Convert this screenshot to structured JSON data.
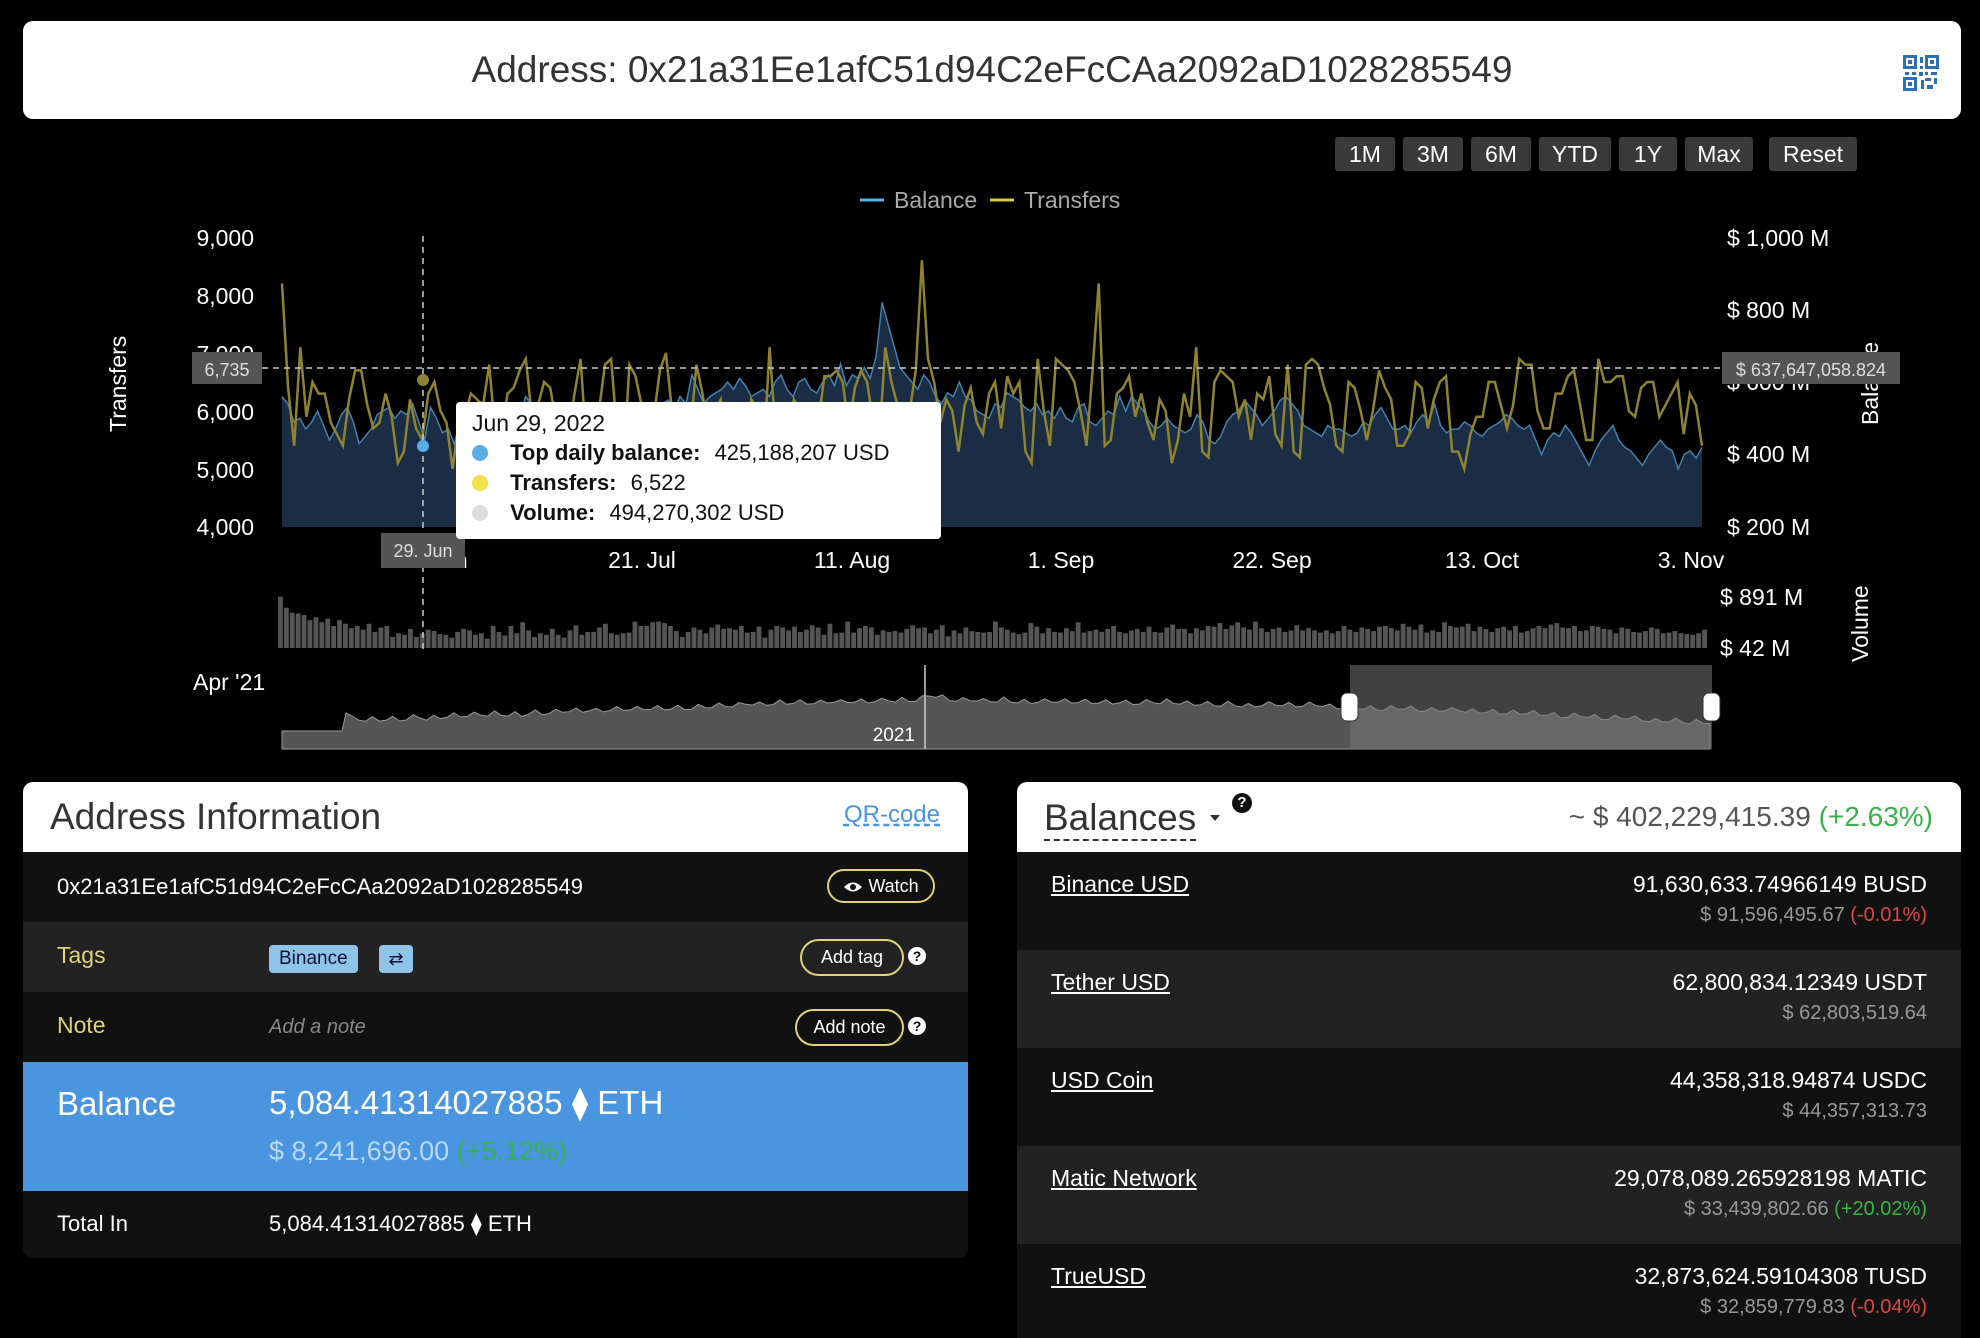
{
  "header": {
    "prefix": "Address:",
    "address": "0x21a31Ee1afC51d94C2eFcCAa2092aD1028285549"
  },
  "range_buttons": [
    "1M",
    "3M",
    "6M",
    "YTD",
    "1Y",
    "Max",
    "Reset"
  ],
  "colors": {
    "balance": "#5aaee8",
    "transfers": "#d8c84a",
    "volume": "#666666",
    "accent_blue": "#4a95df",
    "positive": "#38b24a",
    "negative": "#d94a4a",
    "tag_border": "#e2d17a"
  },
  "chart_data": {
    "type": "line",
    "legend": [
      "Balance",
      "Transfers"
    ],
    "legend_placement": "top-center",
    "x_ticks": [
      "30. Jun",
      "21. Jul",
      "11. Aug",
      "1. Sep",
      "22. Sep",
      "13. Oct",
      "3. Nov"
    ],
    "left_axis": {
      "label": "Transfers",
      "ticks": [
        "9,000",
        "8,000",
        "7,000",
        "6,000",
        "5,000",
        "4,000"
      ],
      "range": [
        4000,
        9000
      ]
    },
    "right_axis": {
      "label": "Balance",
      "ticks": [
        "$ 1,000 M",
        "$ 800 M",
        "$ 600 M",
        "$ 400 M",
        "$ 200 M"
      ],
      "range": [
        200000000,
        1000000000
      ]
    },
    "volume_axis": {
      "label": "Volume",
      "ticks": [
        "$ 891 M",
        "$ 42 M"
      ]
    },
    "crosshair": {
      "left_value": "6,735",
      "right_value": "$ 637,647,058.824",
      "x_label": "29. Jun"
    },
    "tooltip": {
      "date": "Jun 29, 2022",
      "rows": [
        {
          "label": "Top daily balance:",
          "value": "425,188,207 USD",
          "color": "#5aaee8"
        },
        {
          "label": "Transfers:",
          "value": "6,522",
          "color": "#f2e34a"
        },
        {
          "label": "Volume:",
          "value": "494,270,302 USD",
          "color": "#dddddd"
        }
      ]
    },
    "navigator": {
      "start_label": "Apr '21",
      "year_label": "2021"
    },
    "transfers": [
      8200,
      6400,
      5400,
      7100,
      5900,
      6500,
      6300,
      6300,
      5800,
      5600,
      5400,
      6200,
      6700,
      6700,
      6100,
      5700,
      5800,
      6300,
      5900,
      5100,
      5300,
      6200,
      5700,
      5500,
      6300,
      6500,
      6000,
      5800,
      5000,
      5800,
      5900,
      6300,
      6200,
      6100,
      6800,
      5600,
      5600,
      6300,
      6400,
      6700,
      6900,
      5900,
      6100,
      6500,
      6400,
      5800,
      5400,
      5600,
      6300,
      6900,
      5300,
      5400,
      6000,
      6800,
      6900,
      5600,
      5000,
      6800,
      6600,
      6100,
      5700,
      5900,
      6700,
      7000,
      6000,
      5400,
      5100,
      5600,
      6800,
      6300,
      5600,
      6000,
      6200,
      5400,
      5500,
      5200,
      4600,
      6200,
      6000,
      5200,
      7100,
      5600,
      6000,
      5500,
      6200,
      6000,
      5500,
      5500,
      5800,
      6600,
      6600,
      6700,
      6500,
      5700,
      6400,
      6700,
      6500,
      5800,
      5500,
      7100,
      6500,
      6100,
      5600,
      6000,
      6700,
      8600,
      6900,
      6500,
      5800,
      6200,
      6000,
      5300,
      6100,
      6400,
      5800,
      5600,
      6300,
      6500,
      5700,
      6600,
      6300,
      6500,
      5300,
      5100,
      6900,
      6000,
      5400,
      6900,
      6800,
      6700,
      6500,
      6000,
      5400,
      6700,
      8200,
      5400,
      5500,
      6300,
      6400,
      6600,
      5900,
      6300,
      5800,
      5500,
      6200,
      6000,
      5100,
      5500,
      6300,
      5900,
      7100,
      5300,
      5200,
      6500,
      6700,
      6600,
      6500,
      5900,
      6200,
      5500,
      6300,
      6200,
      6600,
      5600,
      5400,
      6800,
      5300,
      5200,
      6800,
      6900,
      6800,
      6400,
      6100,
      5400,
      5300,
      6500,
      6400,
      6000,
      5500,
      6000,
      6700,
      6400,
      6200,
      5400,
      5400,
      5600,
      6500,
      6400,
      5700,
      6200,
      6500,
      6600,
      5300,
      5300,
      5000,
      5600,
      5900,
      5900,
      6500,
      6500,
      6100,
      5700,
      6100,
      6900,
      6800,
      6800,
      6000,
      5700,
      5700,
      6300,
      6300,
      6600,
      6700,
      6100,
      5500,
      5500,
      6900,
      6500,
      6500,
      6600,
      6600,
      6000,
      5900,
      6400,
      6500,
      6500,
      5900,
      6100,
      6300,
      6500,
      5600,
      6300,
      6100,
      5400
    ],
    "balance": [
      560,
      540,
      490,
      500,
      470,
      490,
      520,
      480,
      440,
      470,
      510,
      530,
      490,
      430,
      450,
      470,
      510,
      520,
      530,
      500,
      520,
      510,
      540,
      490,
      440,
      530,
      500,
      460,
      470,
      430,
      490,
      500,
      510,
      460,
      490,
      500,
      500,
      530,
      540,
      520,
      500,
      560,
      540,
      480,
      490,
      530,
      520,
      520,
      530,
      480,
      500,
      520,
      520,
      510,
      490,
      470,
      510,
      500,
      470,
      480,
      510,
      530,
      530,
      520,
      540,
      550,
      520,
      560,
      540,
      620,
      580,
      540,
      560,
      570,
      580,
      600,
      580,
      610,
      590,
      560,
      570,
      580,
      560,
      600,
      620,
      580,
      560,
      600,
      610,
      580,
      570,
      600,
      620,
      590,
      650,
      590,
      620,
      610,
      640,
      610,
      670,
      820,
      760,
      700,
      640,
      620,
      600,
      580,
      620,
      600,
      560,
      540,
      570,
      560,
      600,
      560,
      550,
      520,
      510,
      500,
      540,
      530,
      570,
      560,
      550,
      530,
      520,
      540,
      510,
      520,
      500,
      530,
      500,
      490,
      530,
      540,
      490,
      480,
      500,
      520,
      510,
      560,
      520,
      560,
      540,
      520,
      490,
      470,
      480,
      500,
      480,
      470,
      460,
      470,
      510,
      490,
      440,
      430,
      450,
      490,
      510,
      520,
      550,
      530,
      510,
      480,
      500,
      520,
      550,
      560,
      540,
      520,
      480,
      470,
      460,
      450,
      480,
      470,
      470,
      460,
      450,
      460,
      490,
      480,
      510,
      530,
      500,
      470,
      470,
      480,
      460,
      490,
      510,
      490,
      540,
      480,
      460,
      470,
      470,
      490,
      480,
      460,
      450,
      470,
      480,
      490,
      510,
      500,
      480,
      470,
      480,
      440,
      400,
      440,
      460,
      450,
      480,
      460,
      430,
      400,
      370,
      410,
      440,
      460,
      480,
      440,
      420,
      410,
      390,
      370,
      400,
      420,
      440,
      420,
      410,
      360,
      400,
      410,
      390,
      420
    ],
    "volume": [
      70,
      55,
      48,
      47,
      45,
      38,
      42,
      35,
      40,
      30,
      38,
      33,
      27,
      30,
      25,
      33,
      22,
      28,
      30,
      15,
      20,
      18,
      26,
      15,
      20,
      25,
      23,
      19,
      18,
      14,
      22,
      26,
      24,
      18,
      20,
      13,
      30,
      22,
      17,
      30,
      20,
      35,
      24,
      15,
      20,
      18,
      26,
      18,
      14,
      24,
      31,
      18,
      22,
      22,
      28,
      33,
      20,
      18,
      20,
      21,
      36,
      30,
      30,
      35,
      36,
      34,
      30,
      23,
      15,
      22,
      28,
      25,
      20,
      28,
      32,
      26,
      27,
      25,
      30,
      21,
      22,
      29,
      14,
      25,
      30,
      28,
      24,
      29,
      22,
      25,
      31,
      28,
      18,
      33,
      20,
      21,
      36,
      21,
      27,
      30,
      28,
      18,
      24,
      22,
      23,
      21,
      26,
      31,
      27,
      28,
      20,
      25,
      31,
      16,
      24,
      20,
      28,
      23,
      22,
      21,
      22,
      36,
      28,
      25,
      21,
      19,
      21,
      34,
      29,
      20,
      27,
      22,
      21,
      27,
      23,
      35,
      21,
      23,
      25,
      22,
      26,
      30,
      22,
      20,
      24,
      26,
      22,
      29,
      22,
      21,
      28,
      32,
      26,
      26,
      20,
      27,
      24,
      30,
      29,
      34,
      26,
      31,
      35,
      28,
      25,
      36,
      27,
      22,
      26,
      28,
      22,
      24,
      31,
      24,
      27,
      24,
      21,
      24,
      20,
      23,
      30,
      25,
      22,
      28,
      26,
      23,
      29,
      30,
      27,
      24,
      33,
      29,
      25,
      32,
      21,
      24,
      22,
      35,
      30,
      28,
      29,
      33,
      23,
      29,
      26,
      22,
      27,
      29,
      24,
      30,
      21,
      23,
      27,
      30,
      27,
      32,
      34,
      28,
      27,
      30,
      23,
      24,
      30,
      29,
      26,
      25,
      20,
      28,
      26,
      22,
      21,
      23,
      28,
      26,
      20,
      21,
      23,
      20,
      19,
      18,
      20,
      25
    ]
  },
  "address_info": {
    "title": "Address Information",
    "qr_link": "QR-code",
    "address": "0x21a31Ee1afC51d94C2eFcCAa2092aD1028285549",
    "watch_label": "Watch",
    "tags_label": "Tags",
    "tag_name": "Binance",
    "tag_icon": "swap-icon",
    "add_tag_label": "Add tag",
    "note_label": "Note",
    "note_placeholder": "Add a note",
    "add_note_label": "Add note",
    "balance_label": "Balance",
    "balance_eth": "5,084.41314027885",
    "eth_unit": "ETH",
    "balance_usd": "$ 8,241,696.00",
    "balance_change": "(+5.12%)",
    "total_in_label": "Total In",
    "total_in_eth": "5,084.41314027885",
    "total_in_unit": "ETH"
  },
  "balances": {
    "title": "Balances",
    "help": "?",
    "total": "~ $ 402,229,415.39",
    "total_change": "(+2.63%)",
    "tokens": [
      {
        "name": "Binance USD",
        "amount": "91,630,633.74966149 BUSD",
        "usd": "$ 91,596,495.67",
        "change": "(-0.01%)",
        "change_sign": "negative"
      },
      {
        "name": "Tether USD",
        "amount": "62,800,834.12349 USDT",
        "usd": "$ 62,803,519.64",
        "change": "",
        "change_sign": "none"
      },
      {
        "name": "USD Coin",
        "amount": "44,358,318.94874 USDC",
        "usd": "$ 44,357,313.73",
        "change": "",
        "change_sign": "none"
      },
      {
        "name": "Matic Network",
        "amount": "29,078,089.265928198 MATIC",
        "usd": "$ 33,439,802.66",
        "change": "(+20.02%)",
        "change_sign": "positive"
      },
      {
        "name": "TrueUSD",
        "amount": "32,873,624.59104308 TUSD",
        "usd": "$ 32,859,779.83",
        "change": "(-0.04%)",
        "change_sign": "negative"
      }
    ]
  }
}
